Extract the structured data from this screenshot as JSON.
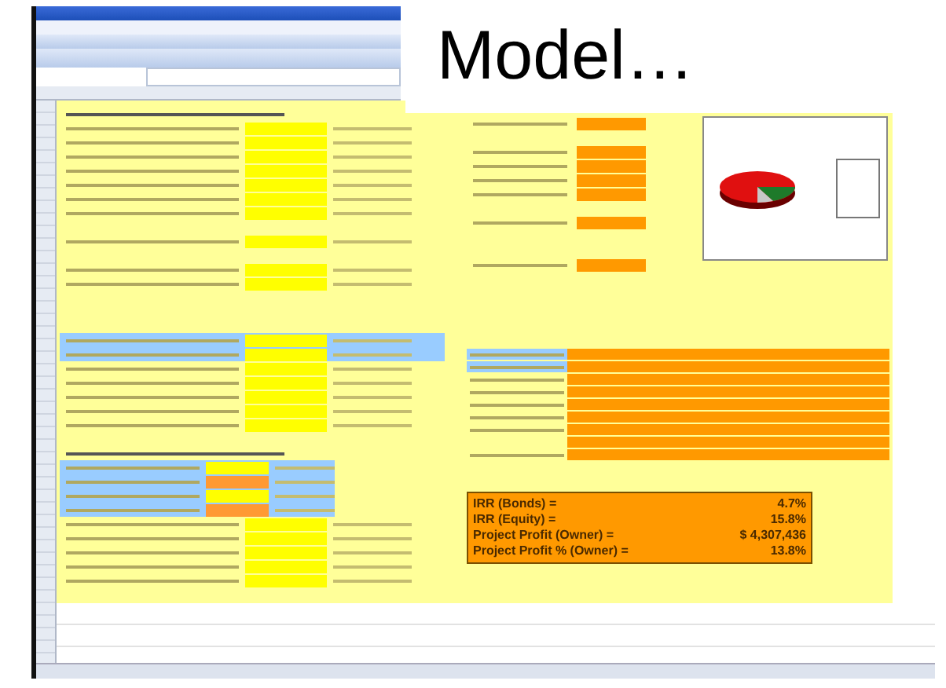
{
  "slide": {
    "title": "Model…"
  },
  "summary": [
    {
      "label": "IRR (Bonds) =",
      "value": "4.7%"
    },
    {
      "label": "IRR (Equity) =",
      "value": "15.8%"
    },
    {
      "label": "Project Profit (Owner) =",
      "value": "$ 4,307,436"
    },
    {
      "label": "Project Profit % (Owner) =",
      "value": "13.8%"
    }
  ]
}
